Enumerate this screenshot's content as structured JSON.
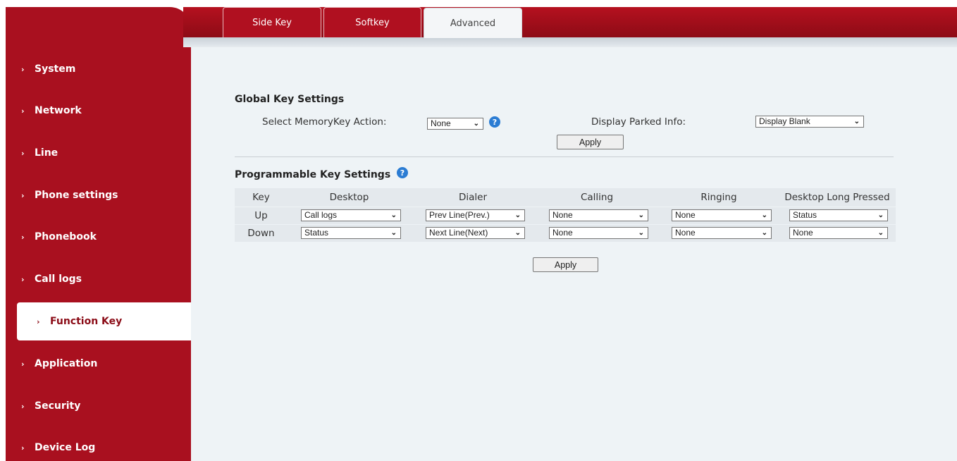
{
  "tabs": [
    {
      "label": "Side Key"
    },
    {
      "label": "Softkey"
    },
    {
      "label": "Advanced"
    }
  ],
  "sidebar": {
    "items": [
      {
        "label": "System"
      },
      {
        "label": "Network"
      },
      {
        "label": "Line"
      },
      {
        "label": "Phone settings"
      },
      {
        "label": "Phonebook"
      },
      {
        "label": "Call logs"
      },
      {
        "label": "Function Key"
      },
      {
        "label": "Application"
      },
      {
        "label": "Security"
      },
      {
        "label": "Device Log"
      }
    ],
    "active": "Function Key"
  },
  "global": {
    "title": "Global Key Settings",
    "memorykey_label": "Select MemoryKey Action:",
    "memorykey_value": "None",
    "parked_label": "Display Parked Info:",
    "parked_value": "Display Blank",
    "apply_label": "Apply"
  },
  "programmable": {
    "title": "Programmable Key Settings",
    "headers": [
      "Key",
      "Desktop",
      "Dialer",
      "Calling",
      "Ringing",
      "Desktop Long Pressed"
    ],
    "rows": [
      {
        "key": "Up",
        "desktop": "Call logs",
        "dialer": "Prev Line(Prev.)",
        "calling": "None",
        "ringing": "None",
        "long": "Status"
      },
      {
        "key": "Down",
        "desktop": "Status",
        "dialer": "Next Line(Next)",
        "calling": "None",
        "ringing": "None",
        "long": "None"
      }
    ],
    "apply_label": "Apply"
  },
  "icons": {
    "help": "question-circle-icon",
    "chevron": "chevron-right-icon",
    "dropdown": "chevron-down-icon"
  },
  "colors": {
    "brand_red": "#a9101f",
    "content_bg": "#eef3f6",
    "help_blue": "#2b7cd3"
  }
}
